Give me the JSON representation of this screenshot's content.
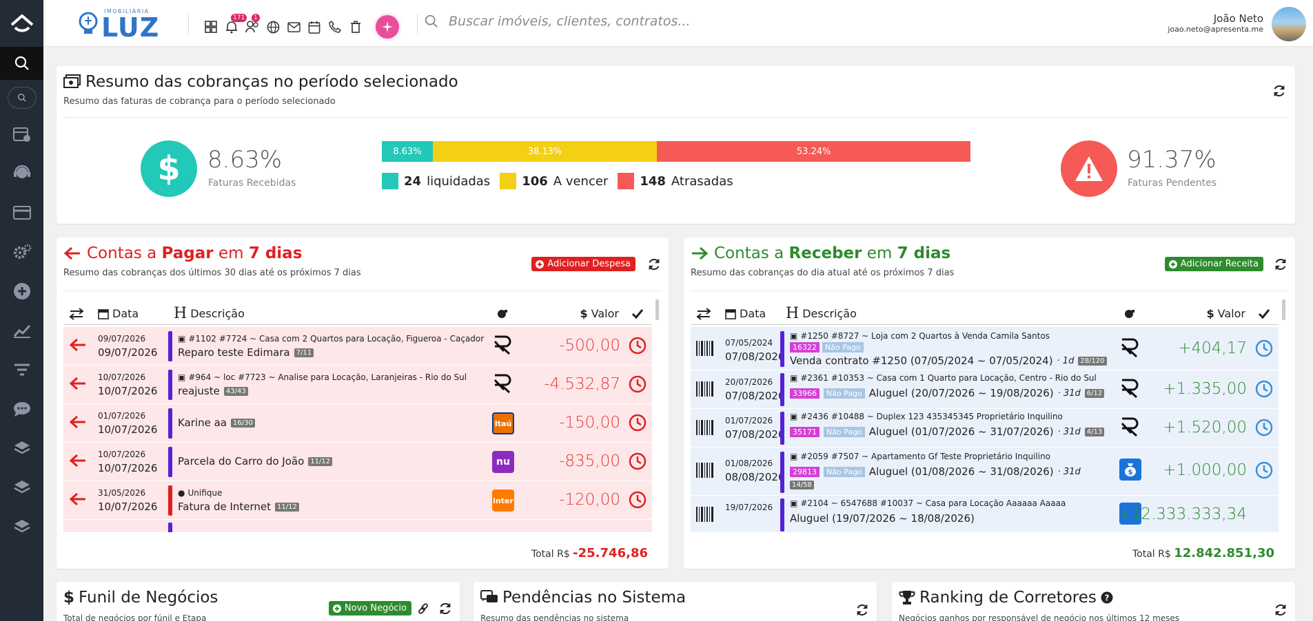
{
  "header": {
    "brand_sub": "IMOBILIÁRIA",
    "brand_name": "LUZ",
    "notif_badge": "171",
    "users_badge": "1",
    "search_placeholder": "Buscar imóveis, clientes, contratos...",
    "user_name": "João Neto",
    "user_email": "joao.neto@apresenta.me"
  },
  "summary": {
    "title": "Resumo das cobranças no período selecionado",
    "subtitle": "Resumo das faturas de cobrança para o período selecionado",
    "received_pct": "8.63%",
    "received_label": "Faturas Recebidas",
    "pending_pct": "91.37%",
    "pending_label": "Faturas Pendentes",
    "bar": [
      {
        "label": "8.63%",
        "value": 8.63,
        "color": "#22c8b8"
      },
      {
        "label": "38.13%",
        "value": 38.13,
        "color": "#f3cf16"
      },
      {
        "label": "53.24%",
        "value": 53.24,
        "color": "#f55a56"
      }
    ],
    "legend": [
      {
        "count": "24",
        "label": "liquidadas",
        "color": "#22c8b8"
      },
      {
        "count": "106",
        "label": "A vencer",
        "color": "#f3cf16"
      },
      {
        "count": "148",
        "label": "Atrasadas",
        "color": "#f55a56"
      }
    ]
  },
  "pagar": {
    "title_a": "Contas a",
    "title_b": "Pagar",
    "title_c": "em",
    "title_d": "7 dias",
    "subtitle": "Resumo das cobranças dos últimos 30 dias até os próximos 7 dias",
    "add_label": "Adicionar Despesa",
    "col_date": "Data",
    "col_desc": "Descrição",
    "col_value": "Valor",
    "total_label": "Total R$",
    "total_value": "-25.746,86",
    "rows": [
      {
        "d1": "09/07/2026",
        "d2": "09/07/2026",
        "meta": "#1102  #7724 ~ Casa com 2 Quartos para Locação, Figueroa - Caçador",
        "desc": "Reparo teste Edimara",
        "tag": "7/11",
        "bank": "R",
        "value": "-500,00",
        "bar": "#5522d6"
      },
      {
        "d1": "10/07/2026",
        "d2": "10/07/2026",
        "meta": "#964 ~ loc  #7723 ~ Analise para Locação, Laranjeiras - Rio do Sul",
        "desc": "reajuste",
        "tag": "43/43",
        "bank": "R",
        "value": "-4.532,87",
        "bar": "#5522d6"
      },
      {
        "d1": "01/07/2026",
        "d2": "10/07/2026",
        "meta": "",
        "desc": "Karine aa",
        "tag": "16/30",
        "bank": "Itaú",
        "value": "-150,00",
        "bar": "#5522d6"
      },
      {
        "d1": "10/07/2026",
        "d2": "10/07/2026",
        "meta": "",
        "desc": "Parcela do Carro do João",
        "tag": "11/12",
        "bank": "nu",
        "value": "-835,00",
        "bar": "#5522d6"
      },
      {
        "d1": "31/05/2026",
        "d2": "10/07/2026",
        "meta": "Unifique",
        "desc": "Fatura de Internet",
        "tag": "11/12",
        "bank": "inter",
        "value": "-120,00",
        "bar": "#e02020"
      }
    ]
  },
  "receber": {
    "title_a": "Contas a",
    "title_b": "Receber",
    "title_c": "em",
    "title_d": "7 dias",
    "subtitle": "Resumo das cobranças do dia atual até os próximos 7 dias",
    "add_label": "Adicionar Receita",
    "col_date": "Data",
    "col_desc": "Descrição",
    "col_value": "Valor",
    "total_label": "Total R$",
    "total_value": "12.842.851,30",
    "rows": [
      {
        "d1": "07/05/2024",
        "d2": "07/08/2026",
        "meta": "#1250  #8727 ~ Loja com 2 Quartos à Venda  Camila Santos",
        "code": "16322",
        "status": "Não Pago",
        "desc": "Venda contrato #1250 (07/05/2024 ~ 07/05/2024)",
        "days": "· 1d",
        "tag": "28/120",
        "value": "+404,17"
      },
      {
        "d1": "20/07/2026",
        "d2": "07/08/2026",
        "meta": "#2361  #10353 ~ Casa com 1 Quarto para Locação, Centro - Rio do Sul",
        "code": "33966",
        "status": "Não Pago",
        "desc": "Aluguel (20/07/2026 ~ 19/08/2026)",
        "days": "· 31d",
        "tag": "6/12",
        "value": "+1.335,00"
      },
      {
        "d1": "01/07/2026",
        "d2": "07/08/2026",
        "meta": "#2436  #10488 ~ Duplex 123  435345345  Proprietário  Inquilino",
        "code": "35171",
        "status": "Não Pago",
        "desc": "Aluguel (01/07/2026 ~ 31/07/2026)",
        "days": "· 31d",
        "tag": "4/13",
        "value": "+1.520,00"
      },
      {
        "d1": "01/08/2026",
        "d2": "08/08/2026",
        "meta": "#2059  #7507 ~ Apartamento  Gf Teste  Proprietário  Inquilino",
        "code": "29813",
        "status": "Não Pago",
        "desc": "Aluguel (01/08/2026 ~ 31/08/2026)",
        "days": "· 31d",
        "tag": "14/58",
        "value": "+1.000,00"
      },
      {
        "d1": "19/07/2026",
        "d2": "",
        "meta": "#2104 ~ 6547688  #10037 ~ Casa para Locação  Aaaaaa Aaaaa",
        "code": "",
        "status": "",
        "desc": "Aluguel (19/07/2026 ~ 18/08/2026)",
        "days": "",
        "tag": "",
        "value": "+12.333.333,34"
      }
    ]
  },
  "bottom": {
    "funil_title": "Funil de Negócios",
    "funil_sub": "Total de negócios por fúnil e Etapa",
    "funil_btn": "Novo Negócio",
    "pend_title": "Pendências no Sistema",
    "pend_sub": "Resumo das pendências no sistema",
    "rank_title": "Ranking de Corretores",
    "rank_sub": "Negócios ganhos por responsável de negócio nos últimos 12 meses"
  }
}
